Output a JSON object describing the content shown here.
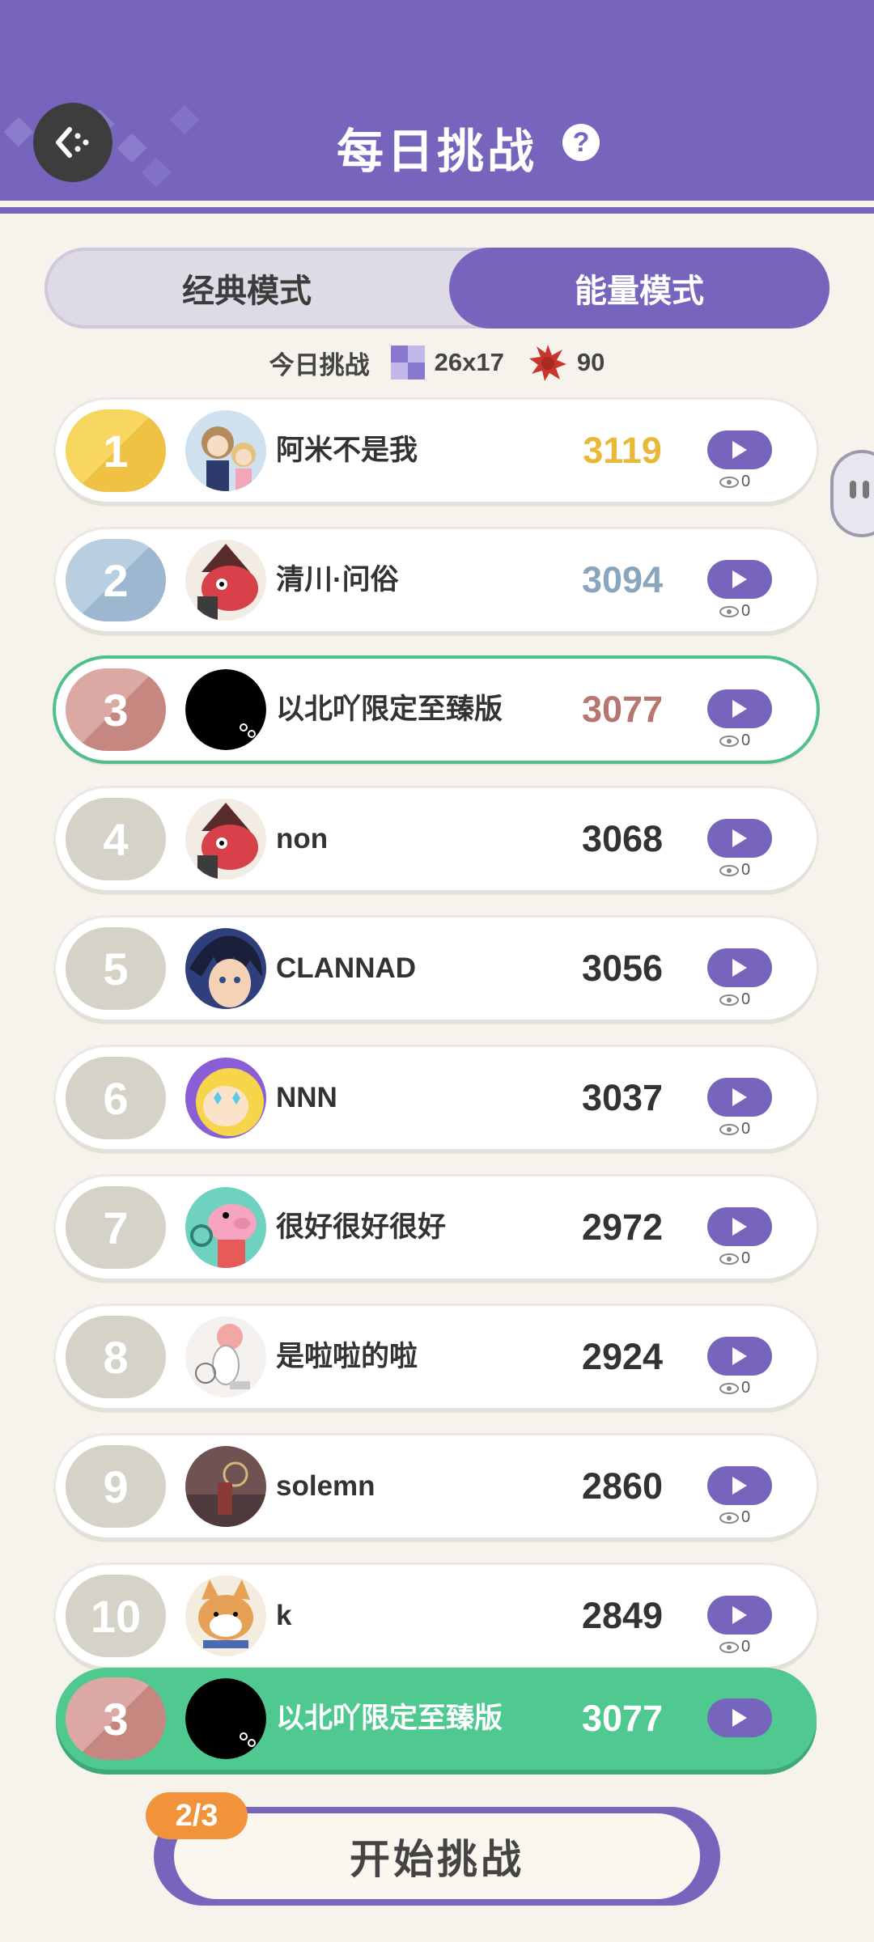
{
  "header": {
    "title": "每日挑战",
    "help_label": "?"
  },
  "mode_tabs": [
    {
      "label": "经典模式",
      "active": false
    },
    {
      "label": "能量模式",
      "active": true
    }
  ],
  "today_challenge": {
    "label": "今日挑战",
    "grid_size": "26x17",
    "energy": "90"
  },
  "leaderboard": [
    {
      "rank": "1",
      "name": "阿米不是我",
      "score": "3119",
      "views": "0"
    },
    {
      "rank": "2",
      "name": "清川·问俗",
      "score": "3094",
      "views": "0"
    },
    {
      "rank": "3",
      "name": "以北吖限定至臻版",
      "score": "3077",
      "views": "0"
    },
    {
      "rank": "4",
      "name": "non",
      "score": "3068",
      "views": "0"
    },
    {
      "rank": "5",
      "name": "CLANNAD",
      "score": "3056",
      "views": "0"
    },
    {
      "rank": "6",
      "name": "NNN",
      "score": "3037",
      "views": "0"
    },
    {
      "rank": "7",
      "name": "很好很好很好",
      "score": "2972",
      "views": "0"
    },
    {
      "rank": "8",
      "name": "是啦啦的啦",
      "score": "2924",
      "views": "0"
    },
    {
      "rank": "9",
      "name": "solemn",
      "score": "2860",
      "views": "0"
    },
    {
      "rank": "10",
      "name": "k",
      "score": "2849",
      "views": "0"
    }
  ],
  "my_rank": {
    "rank": "3",
    "name": "以北吖限定至臻版",
    "score": "3077"
  },
  "start": {
    "label": "开始挑战",
    "attempts": "2/3"
  },
  "colors": {
    "accent": "#7664bd",
    "gold": "#f3c444",
    "silver": "#9ab8d2",
    "bronze": "#c88b84",
    "me_green": "#4fc990",
    "counter_orange": "#f1933a"
  }
}
